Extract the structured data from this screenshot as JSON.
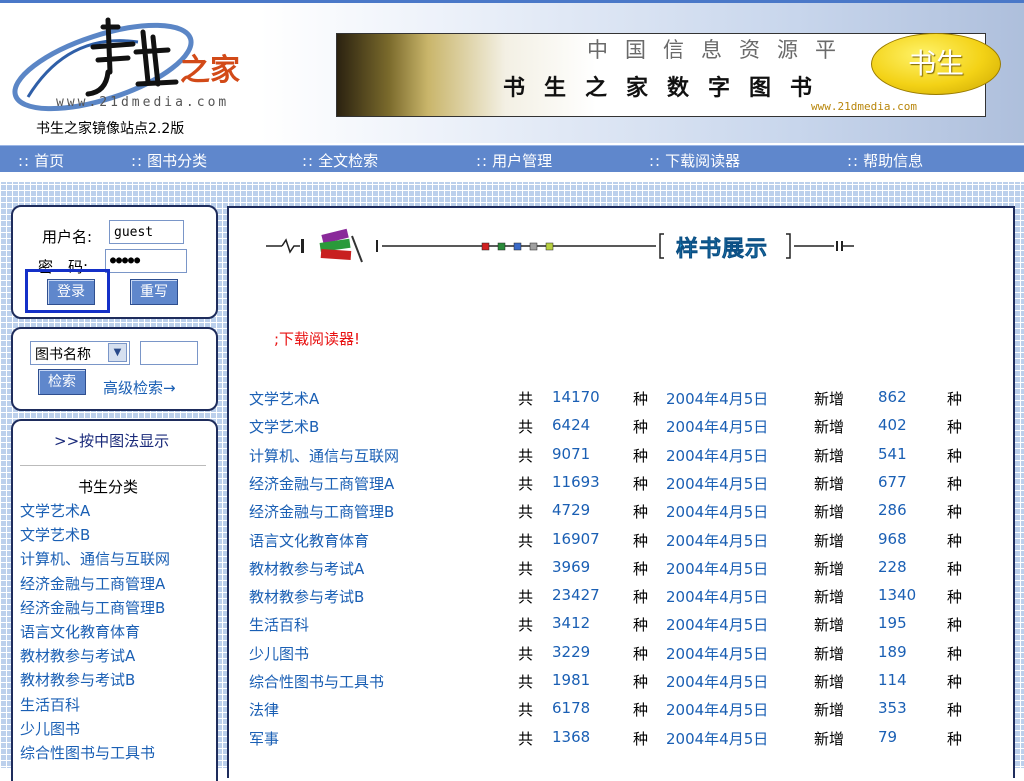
{
  "header": {
    "site_url": "www.21dmedia.com",
    "mirror_label": "书生之家镜像站点2.2版",
    "banner_line1": "中国信息资源平",
    "banner_line2": "书生之家数字图书",
    "banner_url": "www.21dmedia.com",
    "badge_text": "书生",
    "logo_text": "之家"
  },
  "nav": {
    "dots": "::",
    "items": [
      "首页",
      "图书分类",
      "全文检索",
      "用户管理",
      "下载阅读器",
      "帮助信息"
    ]
  },
  "login": {
    "username_label": "用户名:",
    "password_label": "密　码:",
    "username_value": "guest",
    "password_value": "●●●●●",
    "login_button": "登录",
    "reset_button": "重写"
  },
  "search": {
    "field_selected": "图书名称",
    "search_input_value": "",
    "search_button": "检索",
    "advanced_link": "高级检索→"
  },
  "categories": {
    "by_clc_link": ">>按中图法显示",
    "title": "书生分类",
    "items": [
      "文学艺术A",
      "文学艺术B",
      "计算机、通信与互联网",
      "经济金融与工商管理A",
      "经济金融与工商管理B",
      "语言文化教育体育",
      "教材教参与考试A",
      "教材教参与考试B",
      "生活百科",
      "少儿图书",
      "综合性图书与工具书"
    ]
  },
  "content": {
    "sample_title": "样书展示",
    "download_reader": ";下载阅读器!",
    "labels": {
      "gong": "共",
      "zhong": "种",
      "new": "新增"
    },
    "rows": [
      {
        "name": "文学艺术A",
        "count": "14170",
        "date": "2004年4月5日",
        "new_count": "862"
      },
      {
        "name": "文学艺术B",
        "count": "6424",
        "date": "2004年4月5日",
        "new_count": "402"
      },
      {
        "name": "计算机、通信与互联网",
        "count": "9071",
        "date": "2004年4月5日",
        "new_count": "541"
      },
      {
        "name": "经济金融与工商管理A",
        "count": "11693",
        "date": "2004年4月5日",
        "new_count": "677"
      },
      {
        "name": "经济金融与工商管理B",
        "count": "4729",
        "date": "2004年4月5日",
        "new_count": "286"
      },
      {
        "name": "语言文化教育体育",
        "count": "16907",
        "date": "2004年4月5日",
        "new_count": "968"
      },
      {
        "name": "教材教参与考试A",
        "count": "3969",
        "date": "2004年4月5日",
        "new_count": "228"
      },
      {
        "name": "教材教参与考试B",
        "count": "23427",
        "date": "2004年4月5日",
        "new_count": "1340"
      },
      {
        "name": "生活百科",
        "count": "3412",
        "date": "2004年4月5日",
        "new_count": "195"
      },
      {
        "name": "少儿图书",
        "count": "3229",
        "date": "2004年4月5日",
        "new_count": "189"
      },
      {
        "name": "综合性图书与工具书",
        "count": "1981",
        "date": "2004年4月5日",
        "new_count": "114"
      },
      {
        "name": "法律",
        "count": "6178",
        "date": "2004年4月5日",
        "new_count": "353"
      },
      {
        "name": "军事",
        "count": "1368",
        "date": "2004年4月5日",
        "new_count": "79"
      }
    ]
  }
}
